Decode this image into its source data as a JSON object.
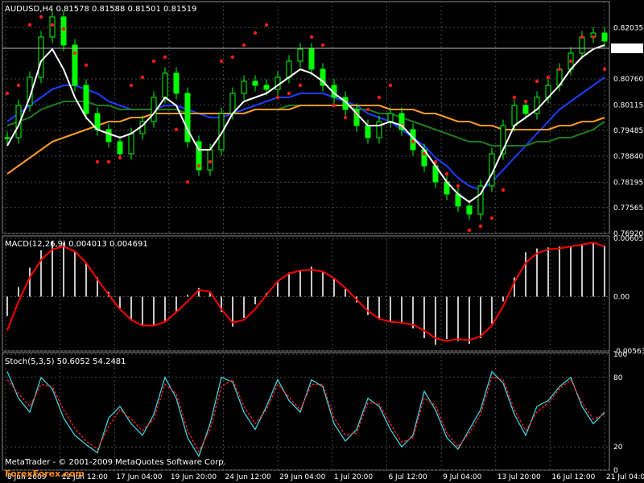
{
  "colors": {
    "background": "#000000",
    "grid": "#4a4a4a",
    "frame": "#8a8a8a",
    "candle": "#00ff00",
    "price_line": "#e8e8e8",
    "ema_fast": "#ffffff",
    "ma_blue": "#1e3cff",
    "ma_green": "#1f7a1f",
    "ma_orange": "#ff9a1f",
    "parabolic_sar": "#ff1a1a",
    "macd_hist": "#c8c8c8",
    "macd_signal": "#ff0000",
    "stoch_main": "#40d0e0",
    "stoch_signal": "#ff2020"
  },
  "chart_data": [
    {
      "type": "line",
      "panel": "price",
      "title": "AUDUSD,H4  0.81578  0.81588  0.81501  0.81519",
      "current_price_label": "0.81519",
      "current_price": 0.81519,
      "ylim": [
        0.7692,
        0.8232
      ],
      "y_ticks": [
        "0.82035",
        "0.80760",
        "0.80115",
        "0.79485",
        "0.78840",
        "0.78195",
        "0.77565",
        "0.76920"
      ],
      "x_ticks": [
        "8 Jun 2009",
        "12 Jun 12:00",
        "17 Jun 04:00",
        "19 Jun 20:00",
        "24 Jun 12:00",
        "29 Jun 04:00",
        "1 Jul 20:00",
        "6 Jul 12:00",
        "9 Jul 04:00",
        "13 Jul 20:00",
        "16 Jul 12:00",
        "21 Jul 04:00"
      ],
      "series": [
        {
          "values": [
            0.793,
            0.801,
            0.808,
            0.818,
            0.823,
            0.816,
            0.806,
            0.799,
            0.795,
            0.792,
            0.789,
            0.794,
            0.797,
            0.803,
            0.809,
            0.804,
            0.792,
            0.785,
            0.79,
            0.799,
            0.804,
            0.807,
            0.806,
            0.805,
            0.808,
            0.812,
            0.815,
            0.81,
            0.806,
            0.803,
            0.8,
            0.796,
            0.793,
            0.797,
            0.799,
            0.795,
            0.79,
            0.786,
            0.782,
            0.779,
            0.776,
            0.774,
            0.781,
            0.789,
            0.796,
            0.801,
            0.799,
            0.803,
            0.806,
            0.81,
            0.814,
            0.818,
            0.819,
            0.817
          ]
        },
        {
          "values": [
            0.791,
            0.796,
            0.803,
            0.812,
            0.815,
            0.81,
            0.803,
            0.798,
            0.795,
            0.794,
            0.793,
            0.794,
            0.796,
            0.799,
            0.803,
            0.801,
            0.795,
            0.79,
            0.79,
            0.794,
            0.799,
            0.802,
            0.803,
            0.804,
            0.806,
            0.808,
            0.81,
            0.809,
            0.807,
            0.804,
            0.802,
            0.799,
            0.796,
            0.796,
            0.797,
            0.796,
            0.793,
            0.79,
            0.786,
            0.782,
            0.779,
            0.777,
            0.779,
            0.784,
            0.79,
            0.796,
            0.798,
            0.8,
            0.803,
            0.806,
            0.81,
            0.813,
            0.815,
            0.816
          ]
        },
        {
          "values": [
            0.797,
            0.799,
            0.801,
            0.803,
            0.805,
            0.806,
            0.806,
            0.805,
            0.804,
            0.802,
            0.801,
            0.8,
            0.8,
            0.8,
            0.801,
            0.801,
            0.8,
            0.799,
            0.798,
            0.798,
            0.799,
            0.8,
            0.801,
            0.802,
            0.803,
            0.803,
            0.804,
            0.804,
            0.804,
            0.803,
            0.802,
            0.801,
            0.799,
            0.798,
            0.797,
            0.795,
            0.793,
            0.791,
            0.788,
            0.786,
            0.783,
            0.781,
            0.78,
            0.782,
            0.785,
            0.788,
            0.791,
            0.794,
            0.797,
            0.8,
            0.802,
            0.804,
            0.806,
            0.808
          ]
        },
        {
          "values": [
            0.796,
            0.797,
            0.798,
            0.8,
            0.801,
            0.802,
            0.802,
            0.802,
            0.801,
            0.801,
            0.8,
            0.8,
            0.8,
            0.8,
            0.8,
            0.8,
            0.799,
            0.799,
            0.799,
            0.799,
            0.799,
            0.799,
            0.8,
            0.8,
            0.8,
            0.801,
            0.801,
            0.801,
            0.801,
            0.801,
            0.801,
            0.8,
            0.8,
            0.799,
            0.799,
            0.798,
            0.797,
            0.796,
            0.795,
            0.794,
            0.793,
            0.792,
            0.792,
            0.791,
            0.791,
            0.791,
            0.791,
            0.792,
            0.792,
            0.793,
            0.793,
            0.794,
            0.795,
            0.797
          ]
        },
        {
          "values": [
            0.784,
            0.786,
            0.788,
            0.79,
            0.792,
            0.793,
            0.794,
            0.795,
            0.796,
            0.797,
            0.797,
            0.798,
            0.798,
            0.799,
            0.799,
            0.799,
            0.799,
            0.799,
            0.799,
            0.799,
            0.799,
            0.799,
            0.8,
            0.8,
            0.8,
            0.8,
            0.801,
            0.801,
            0.801,
            0.801,
            0.801,
            0.801,
            0.801,
            0.801,
            0.8,
            0.8,
            0.8,
            0.799,
            0.799,
            0.798,
            0.797,
            0.797,
            0.796,
            0.796,
            0.795,
            0.795,
            0.795,
            0.795,
            0.795,
            0.796,
            0.796,
            0.797,
            0.797,
            0.798
          ]
        },
        {
          "values": [
            0.804,
            0.806,
            0.821,
            0.823,
            0.821,
            0.82,
            0.814,
            0.811,
            0.787,
            0.787,
            0.788,
            0.806,
            0.808,
            0.812,
            0.813,
            0.795,
            0.782,
            0.786,
            0.787,
            0.812,
            0.813,
            0.816,
            0.819,
            0.821,
            0.803,
            0.804,
            0.806,
            0.818,
            0.816,
            0.801,
            0.798,
            0.799,
            0.8,
            0.803,
            0.806,
            0.796,
            0.792,
            0.789,
            0.787,
            0.784,
            0.781,
            0.77,
            0.771,
            0.773,
            0.78,
            0.803,
            0.802,
            0.807,
            0.808,
            0.81,
            0.812,
            0.818,
            0.818,
            0.81
          ]
        }
      ]
    },
    {
      "type": "bar",
      "panel": "macd",
      "title": "MACD(12,26,9) 0.004013 0.004691",
      "ylim": [
        -0.00563,
        0.00605
      ],
      "y_ticks": [
        "0.006057",
        "0.00",
        "-0.00563"
      ],
      "series": [
        {
          "values": [
            -0.002,
            0.001,
            0.003,
            0.0048,
            0.0058,
            0.0056,
            0.0047,
            0.0035,
            0.002,
            0.0005,
            -0.0012,
            -0.0025,
            -0.003,
            -0.003,
            -0.0025,
            -0.0015,
            0.0002,
            0.0009,
            0.0004,
            -0.0016,
            -0.0031,
            -0.0022,
            -0.0008,
            0.0004,
            0.0016,
            0.0025,
            0.0028,
            0.0031,
            0.0026,
            0.0018,
            0.0008,
            -0.0006,
            -0.0019,
            -0.0024,
            -0.0026,
            -0.0028,
            -0.0033,
            -0.0043,
            -0.005,
            -0.0044,
            -0.0046,
            -0.0049,
            -0.0043,
            -0.0028,
            -0.0005,
            0.002,
            0.0046,
            0.005,
            0.0051,
            0.0052,
            0.0052,
            0.0054,
            0.0056,
            0.0053
          ]
        },
        {
          "values": [
            -0.0035,
            -0.0005,
            0.002,
            0.0038,
            0.0049,
            0.0052,
            0.0047,
            0.0035,
            0.0018,
            0.0002,
            -0.0013,
            -0.0024,
            -0.003,
            -0.003,
            -0.0026,
            -0.0016,
            -0.0005,
            0.0007,
            0.0005,
            -0.0013,
            -0.0027,
            -0.0024,
            -0.0013,
            0.0002,
            0.0016,
            0.0024,
            0.0027,
            0.0028,
            0.0026,
            0.0019,
            0.0009,
            -0.0003,
            -0.0015,
            -0.0023,
            -0.0026,
            -0.0027,
            -0.0029,
            -0.0035,
            -0.0043,
            -0.0046,
            -0.0044,
            -0.0045,
            -0.0041,
            -0.003,
            -0.001,
            0.0015,
            0.0035,
            0.0045,
            0.0049,
            0.005,
            0.0052,
            0.0054,
            0.0056,
            0.0052
          ]
        }
      ]
    },
    {
      "type": "line",
      "panel": "stochastic",
      "title": "Stoch(5,3,5) 50.6052 54.2481",
      "ylim": [
        0,
        100
      ],
      "y_ticks": [
        "100",
        "80",
        "20",
        "0"
      ],
      "series": [
        {
          "values": [
            85,
            62,
            50,
            80,
            70,
            45,
            30,
            22,
            15,
            45,
            55,
            40,
            30,
            48,
            80,
            62,
            28,
            12,
            40,
            80,
            76,
            50,
            35,
            55,
            78,
            60,
            50,
            78,
            72,
            40,
            25,
            35,
            62,
            55,
            35,
            20,
            30,
            68,
            52,
            28,
            18,
            35,
            52,
            85,
            75,
            48,
            30,
            55,
            60,
            72,
            80,
            55,
            40,
            50
          ]
        },
        {
          "values": [
            78,
            66,
            55,
            74,
            72,
            52,
            36,
            25,
            18,
            38,
            52,
            44,
            34,
            44,
            74,
            66,
            34,
            16,
            35,
            72,
            78,
            55,
            40,
            52,
            74,
            63,
            52,
            74,
            74,
            45,
            30,
            32,
            58,
            57,
            40,
            24,
            28,
            62,
            56,
            32,
            20,
            32,
            48,
            80,
            78,
            52,
            34,
            50,
            58,
            70,
            78,
            58,
            44,
            48
          ]
        }
      ]
    }
  ],
  "watermark": {
    "line1": "MetaTrader - © 2001-2009 MetaQuotes Software Corp.",
    "site": "ForexForex.com"
  }
}
